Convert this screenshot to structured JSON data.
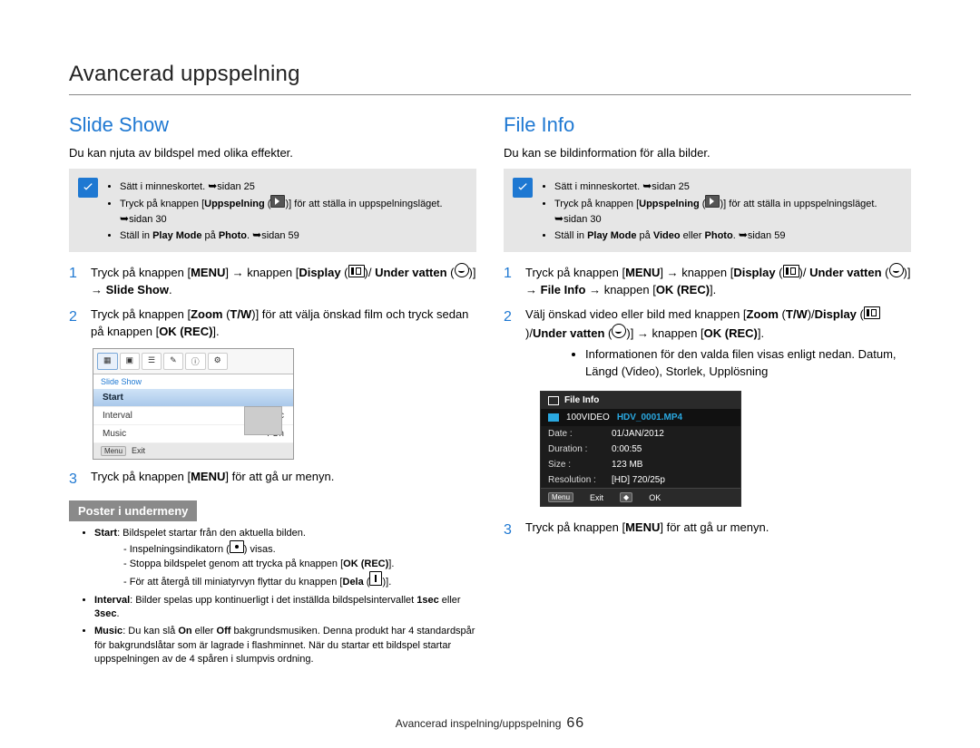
{
  "page_title": "Avancerad uppspelning",
  "footer": {
    "section": "Avancerad inspelning/uppspelning",
    "page": "66"
  },
  "left": {
    "title": "Slide Show",
    "intro": "Du kan njuta av bildspel med olika effekter.",
    "notes": {
      "n1a": "Sätt i minneskortet. ",
      "n1b": "sidan 25",
      "n2a": "Tryck på knappen [",
      "n2b": "Uppspelning",
      "n2c": " (",
      "n2d": ")] för att ställa in uppspelningsläget. ",
      "n2e": "sidan 30",
      "n3a": "Ställ in ",
      "n3b": "Play Mode",
      "n3c": " på ",
      "n3d": "Photo",
      "n3e": ". ",
      "n3f": "sidan 59"
    },
    "step1": {
      "a": "Tryck på knappen [",
      "menu": "MENU",
      "b": "] ",
      "arrow1": "→",
      "c": " knappen [",
      "disp": "Display",
      "d": " (",
      "e": ")/ ",
      "uw": "Under vatten",
      "f": " (",
      "g": ")] ",
      "arrow2": "→",
      "h": " ",
      "ss": "Slide Show",
      "i": "."
    },
    "step2": {
      "a": "Tryck på knappen [",
      "zoom": "Zoom",
      "b": " (",
      "tw": "T/W",
      "c": ")] för att välja önskad film och tryck sedan på knappen [",
      "ok": "OK (REC)",
      "d": "]."
    },
    "device": {
      "crumb": "Slide Show",
      "row_start": "Start",
      "row_interval_k": "Interval",
      "row_interval_v": ": 1Sec",
      "row_music_k": "Music",
      "row_music_v": ": On",
      "exit": "Exit",
      "menu_chip": "Menu"
    },
    "step3": {
      "a": "Tryck på knappen [",
      "menu": "MENU",
      "b": "] för att gå ur menyn."
    },
    "sub_header": "Poster i undermeny",
    "sub": {
      "s1a": "Start",
      "s1b": ": Bildspelet startar från den aktuella bilden.",
      "s1c": "- Inspelningsindikatorn (",
      "s1d": ") visas.",
      "s1e": "- Stoppa bildspelet genom att trycka på knappen [",
      "s1f": "OK (REC)",
      "s1g": "].",
      "s1h": "- För att återgå till miniatyrvyn flyttar du knappen [",
      "s1i": "Dela",
      "s1j": " (",
      "s1k": ")].",
      "s2a": "Interval",
      "s2b": ": Bilder spelas upp kontinuerligt i det inställda bildspelsintervallet ",
      "s2c": "1sec",
      "s2d": " eller ",
      "s2e": "3sec",
      "s2f": ".",
      "s3a": "Music",
      "s3b": ": Du kan slå ",
      "s3c": "On",
      "s3d": " eller ",
      "s3e": "Off",
      "s3f": " bakgrundsmusiken. Denna produkt har 4 standardspår för bakgrundslåtar som är lagrade i flashminnet. När du startar ett bildspel startar uppspelningen av de 4 spåren i slumpvis ordning."
    }
  },
  "right": {
    "title": "File Info",
    "intro": "Du kan se bildinformation för alla bilder.",
    "notes": {
      "n1a": "Sätt i minneskortet. ",
      "n1b": "sidan 25",
      "n2a": "Tryck på knappen [",
      "n2b": "Uppspelning",
      "n2c": " (",
      "n2d": ")] för att ställa in uppspelningsläget. ",
      "n2e": "sidan 30",
      "n3a": "Ställ in ",
      "n3b": "Play Mode",
      "n3c": " på ",
      "n3d": "Video",
      "n3e": " eller ",
      "n3f": "Photo",
      "n3g": ". ",
      "n3h": "sidan 59"
    },
    "step1": {
      "a": "Tryck på knappen [",
      "menu": "MENU",
      "b": "] ",
      "arrow1": "→",
      "c": " knappen [",
      "disp": "Display",
      "d": " (",
      "e": ")/ ",
      "uw": "Under vatten",
      "f": " (",
      "g": ")] ",
      "arrow2": "→",
      "h": " ",
      "fi": "File Info",
      "i": " ",
      "arrow3": "→",
      "j": " knappen [",
      "ok": "OK (REC)",
      "k": "]."
    },
    "step2": {
      "a": "Välj önskad video eller bild med knappen [",
      "zoom": "Zoom",
      "b": " (",
      "tw": "T/W",
      "c": ")/",
      "disp": "Display",
      "d": " (",
      "e": ")/",
      "uw": "Under vatten",
      "f": " (",
      "g": ")] ",
      "arrow": "→",
      "h": " knappen [",
      "ok": "OK (REC)",
      "i": "].",
      "bul1": "Informationen för den valda filen visas enligt nedan. Datum, Längd (Video), Storlek, Upplösning"
    },
    "device": {
      "hdr": "File Info",
      "folder": "100VIDEO",
      "fname": "HDV_0001.MP4",
      "date_k": "Date :",
      "date_v": "01/JAN/2012",
      "dur_k": "Duration :",
      "dur_v": "0:00:55",
      "size_k": "Size :",
      "size_v": "123 MB",
      "res_k": "Resolution :",
      "res_v": "[HD] 720/25p",
      "exit": "Exit",
      "ok": "OK",
      "menu_chip": "Menu"
    },
    "step3": {
      "a": "Tryck på knappen [",
      "menu": "MENU",
      "b": "] för att gå ur menyn."
    }
  }
}
